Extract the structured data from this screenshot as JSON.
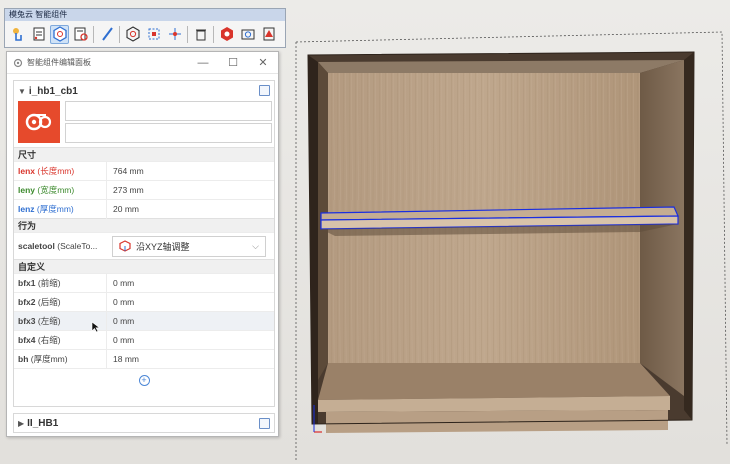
{
  "toolbar": {
    "title": "模兔云 智能组件",
    "buttons": [
      {
        "icon": "pointer-hand-icon"
      },
      {
        "icon": "doc-list-icon"
      },
      {
        "icon": "component-hex-icon",
        "active": true
      },
      {
        "icon": "doc-search-icon"
      },
      {
        "icon": "pencil-icon"
      },
      {
        "icon": "gear-hex-icon"
      },
      {
        "icon": "select-box-icon"
      },
      {
        "icon": "move-arrows-icon"
      },
      {
        "icon": "trash-icon"
      },
      {
        "icon": "solid-gear-icon"
      },
      {
        "icon": "camera-gear-icon"
      },
      {
        "icon": "warning-stack-icon"
      }
    ]
  },
  "panel": {
    "title": "智能组件编辑面板",
    "controls": {
      "minimize": "—",
      "maximize": "☐",
      "close": "✕"
    },
    "component": {
      "name": "i_hb1_cb1",
      "sections": {
        "size": {
          "label": "尺寸",
          "rows": [
            {
              "key": "lenx",
              "sub": "(长度mm)",
              "value": "764 mm"
            },
            {
              "key": "leny",
              "sub": "(宽度mm)",
              "value": "273 mm"
            },
            {
              "key": "lenz",
              "sub": "(厚度mm)",
              "value": "20 mm"
            }
          ]
        },
        "behavior": {
          "label": "行为",
          "row": {
            "key": "scaletool",
            "sub": "(ScaleTo...",
            "value": "沿XYZ轴调整"
          }
        },
        "custom": {
          "label": "自定义",
          "rows": [
            {
              "key": "bfx1",
              "sub": "(前缩)",
              "value": "0 mm"
            },
            {
              "key": "bfx2",
              "sub": "(后缩)",
              "value": "0 mm"
            },
            {
              "key": "bfx3",
              "sub": "(左缩)",
              "value": "0 mm"
            },
            {
              "key": "bfx4",
              "sub": "(右缩)",
              "value": "0 mm"
            },
            {
              "key": "bh",
              "sub": "(厚度mm)",
              "value": "18 mm"
            }
          ]
        }
      }
    },
    "collapsed_component": {
      "name": "II_HB1"
    }
  },
  "colors": {
    "logo_bg": "#e64a2c",
    "lenx_key": "#d9352c",
    "leny_key": "#3c8a2d",
    "lenz_key": "#2f6fd1",
    "selection_blue": "#1a2ee0",
    "wood": "#b59a7f"
  }
}
